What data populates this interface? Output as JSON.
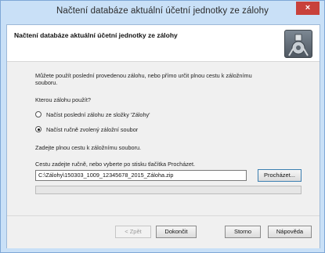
{
  "window": {
    "title": "Načtení databáze aktuální účetní jednotky ze zálohy",
    "close_symbol": "×"
  },
  "header": {
    "title": "Načtení databáze aktuální účetní jednotky ze zálohy",
    "icon": "wizard-icon"
  },
  "body": {
    "intro_line1": "Můžete použít poslední provedenou zálohu, nebo přímo určit plnou cestu k záložnímu",
    "intro_line2": "souboru.",
    "question": "Kterou zálohu použít?",
    "options": [
      {
        "label": "Načíst poslední zálohu ze složky 'Zálohy'",
        "selected": false
      },
      {
        "label": "Načíst ručně zvolený záložní soubor",
        "selected": true
      }
    ],
    "path_prompt": "Zadejte plnou cestu k záložnímu souboru.",
    "path_hint": "Cestu zadejte ručně, nebo vyberte po stisku tlačítka Procházet.",
    "path_value": "C:\\Zálohy\\150303_1009_12345678_2015_Záloha.zip",
    "browse_label": "Procházet...",
    "progress": 0
  },
  "footer": {
    "back_label": "< Zpět",
    "finish_label": "Dokončit",
    "cancel_label": "Storno",
    "help_label": "Nápověda"
  }
}
